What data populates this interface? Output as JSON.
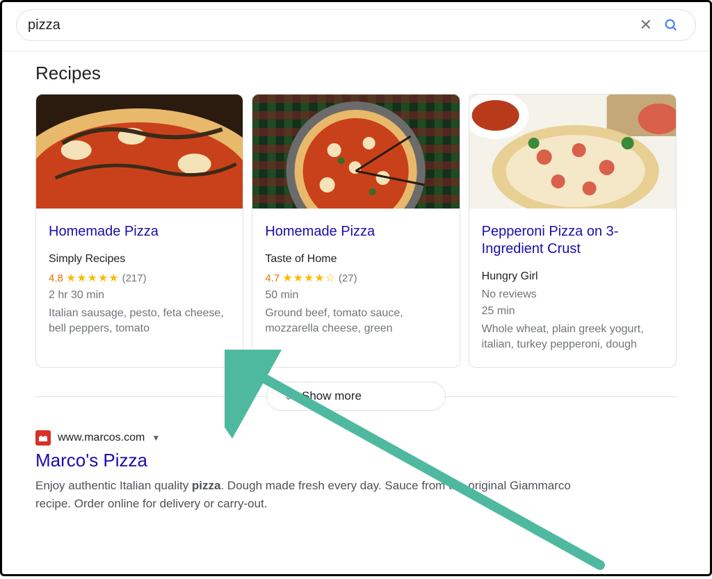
{
  "search": {
    "query": "pizza",
    "clear_label": "Clear search",
    "search_label": "Search"
  },
  "recipes_section": {
    "title": "Recipes",
    "show_more_label": "Show more",
    "cards": [
      {
        "title": "Homemade Pizza",
        "source": "Simply Recipes",
        "rating": "4.8",
        "stars": "★★★★★",
        "review_count": "(217)",
        "time": "2 hr 30 min",
        "ingredients": "Italian sausage, pesto, feta cheese, bell peppers, tomato"
      },
      {
        "title": "Homemade Pizza",
        "source": "Taste of Home",
        "rating": "4.7",
        "stars": "★★★★☆",
        "review_count": "(27)",
        "time": "50 min",
        "ingredients": "Ground beef, tomato sauce, mozzarella cheese, green"
      },
      {
        "title": "Pepperoni Pizza on 3-Ingredient Crust",
        "source": "Hungry Girl",
        "no_reviews": "No reviews",
        "time": "25 min",
        "ingredients": "Whole wheat, plain greek yogurt, italian, turkey pepperoni, dough"
      }
    ]
  },
  "organic_result": {
    "url": "www.marcos.com",
    "title": "Marco's Pizza",
    "desc_before": "Enjoy authentic Italian quality ",
    "desc_bold": "pizza",
    "desc_after": ". Dough made fresh every day. Sauce from the original Giammarco recipe. Order online for delivery or carry-out."
  },
  "colors": {
    "link": "#1a0dab",
    "star": "#fbbc04",
    "rating": "#e37400",
    "arrow": "#4fb9a0"
  }
}
